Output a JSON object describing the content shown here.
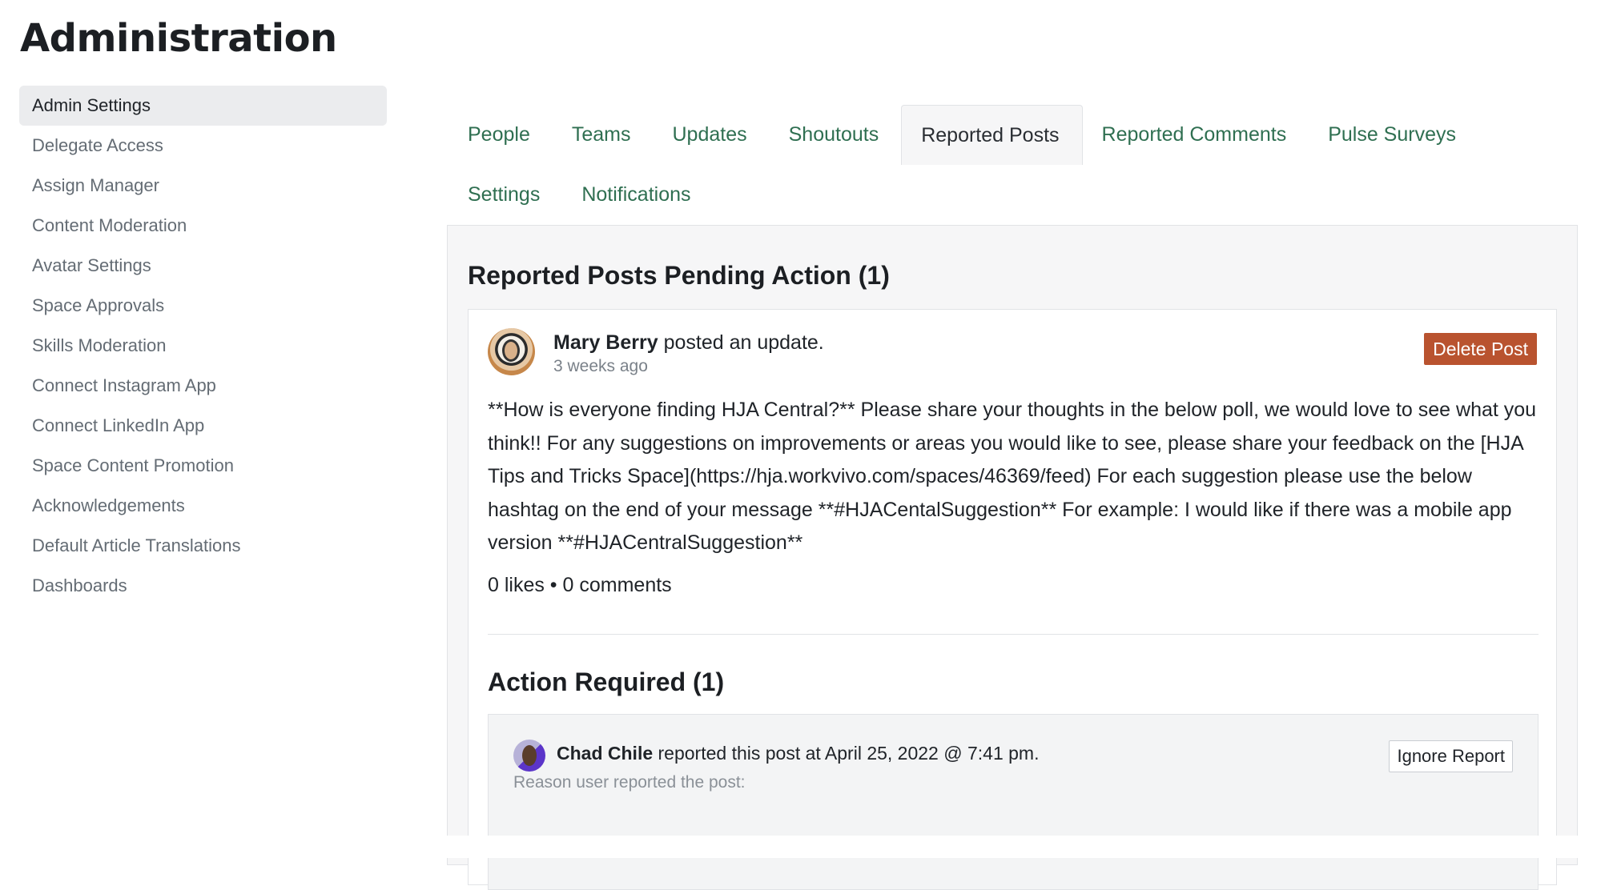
{
  "page": {
    "title": "Administration"
  },
  "sidebar": {
    "items": [
      {
        "label": "Admin Settings",
        "active": true
      },
      {
        "label": "Delegate Access"
      },
      {
        "label": "Assign Manager"
      },
      {
        "label": "Content Moderation"
      },
      {
        "label": "Avatar Settings"
      },
      {
        "label": "Space Approvals"
      },
      {
        "label": "Skills Moderation"
      },
      {
        "label": "Connect Instagram App"
      },
      {
        "label": "Connect LinkedIn App"
      },
      {
        "label": "Space Content Promotion"
      },
      {
        "label": "Acknowledgements"
      },
      {
        "label": "Default Article Translations"
      },
      {
        "label": "Dashboards"
      }
    ]
  },
  "tabs": {
    "row1": [
      "People",
      "Teams",
      "Updates",
      "Shoutouts",
      "Reported Posts",
      "Reported Comments",
      "Pulse Surveys"
    ],
    "row2": [
      "Settings",
      "Notifications"
    ],
    "active": "Reported Posts"
  },
  "main": {
    "heading": "Reported Posts Pending Action (1)",
    "post": {
      "author": "Mary Berry",
      "action": " posted an update.",
      "time": "3 weeks ago",
      "delete_label": "Delete Post",
      "body": "**How is everyone finding HJA Central?** Please share your thoughts in the below poll, we would love to see what you think!! For any suggestions on improvements or areas you would like to see, please share your feedback on the [HJA Tips and Tricks Space](https://hja.workvivo.com/spaces/46369/feed) For each suggestion please use the below hashtag on the end of your message **#HJACentalSuggestion** For example: I would like if there was a mobile app version **#HJACentralSuggestion**",
      "stats": "0 likes • 0 comments"
    },
    "action_required": {
      "heading": "Action Required (1)",
      "report": {
        "reporter": "Chad Chile",
        "text": " reported this post at April 25, 2022 @ 7:41 pm.",
        "reason_label": "Reason user reported the post:",
        "ignore_label": "Ignore Report"
      }
    }
  },
  "colors": {
    "accent_green": "#2f6f51",
    "delete_red": "#b9532f",
    "sidebar_active_bg": "#ebecee",
    "panel_bg": "#f6f6f7"
  }
}
